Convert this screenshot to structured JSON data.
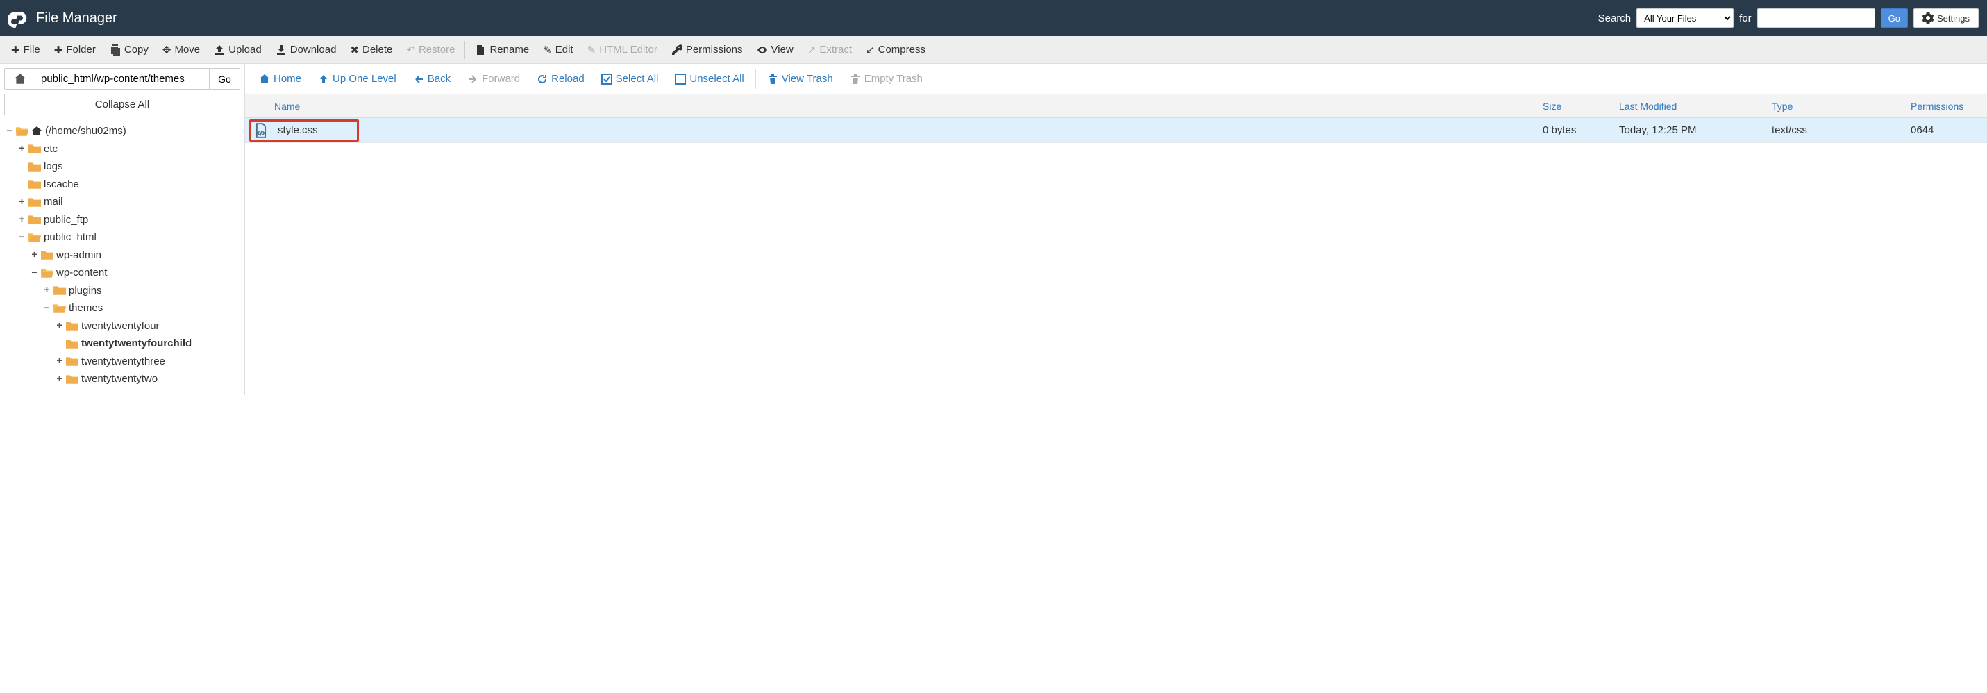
{
  "header": {
    "title": "File Manager",
    "search_label": "Search",
    "search_scope": "All Your Files",
    "for_label": "for",
    "search_value": "",
    "go": "Go",
    "settings": "Settings"
  },
  "toolbar": {
    "file": "File",
    "folder": "Folder",
    "copy": "Copy",
    "move": "Move",
    "upload": "Upload",
    "download": "Download",
    "delete": "Delete",
    "restore": "Restore",
    "rename": "Rename",
    "edit": "Edit",
    "html_editor": "HTML Editor",
    "permissions": "Permissions",
    "view": "View",
    "extract": "Extract",
    "compress": "Compress"
  },
  "path": {
    "value": "public_html/wp-content/themes",
    "go": "Go"
  },
  "collapse_all": "Collapse All",
  "tree": {
    "root": "(/home/shu02ms)",
    "items": [
      {
        "label": "etc",
        "toggle": "+",
        "open": false,
        "indent": 1
      },
      {
        "label": "logs",
        "toggle": "",
        "open": false,
        "indent": 1
      },
      {
        "label": "lscache",
        "toggle": "",
        "open": false,
        "indent": 1
      },
      {
        "label": "mail",
        "toggle": "+",
        "open": false,
        "indent": 1
      },
      {
        "label": "public_ftp",
        "toggle": "+",
        "open": false,
        "indent": 1
      },
      {
        "label": "public_html",
        "toggle": "−",
        "open": true,
        "indent": 1
      },
      {
        "label": "wp-admin",
        "toggle": "+",
        "open": false,
        "indent": 2
      },
      {
        "label": "wp-content",
        "toggle": "−",
        "open": true,
        "indent": 2
      },
      {
        "label": "plugins",
        "toggle": "+",
        "open": false,
        "indent": 3
      },
      {
        "label": "themes",
        "toggle": "−",
        "open": true,
        "indent": 3
      },
      {
        "label": "twentytwentyfour",
        "toggle": "+",
        "open": false,
        "indent": 4
      },
      {
        "label": "twentytwentyfourchild",
        "toggle": "",
        "open": false,
        "indent": 4,
        "bold": true
      },
      {
        "label": "twentytwentythree",
        "toggle": "+",
        "open": false,
        "indent": 4
      },
      {
        "label": "twentytwentytwo",
        "toggle": "+",
        "open": false,
        "indent": 4
      }
    ]
  },
  "actionbar": {
    "home": "Home",
    "up": "Up One Level",
    "back": "Back",
    "forward": "Forward",
    "reload": "Reload",
    "select_all": "Select All",
    "unselect_all": "Unselect All",
    "view_trash": "View Trash",
    "empty_trash": "Empty Trash"
  },
  "columns": {
    "name": "Name",
    "size": "Size",
    "modified": "Last Modified",
    "type": "Type",
    "permissions": "Permissions"
  },
  "rows": [
    {
      "name": "style.css",
      "size": "0 bytes",
      "modified": "Today, 12:25 PM",
      "type": "text/css",
      "permissions": "0644"
    }
  ]
}
